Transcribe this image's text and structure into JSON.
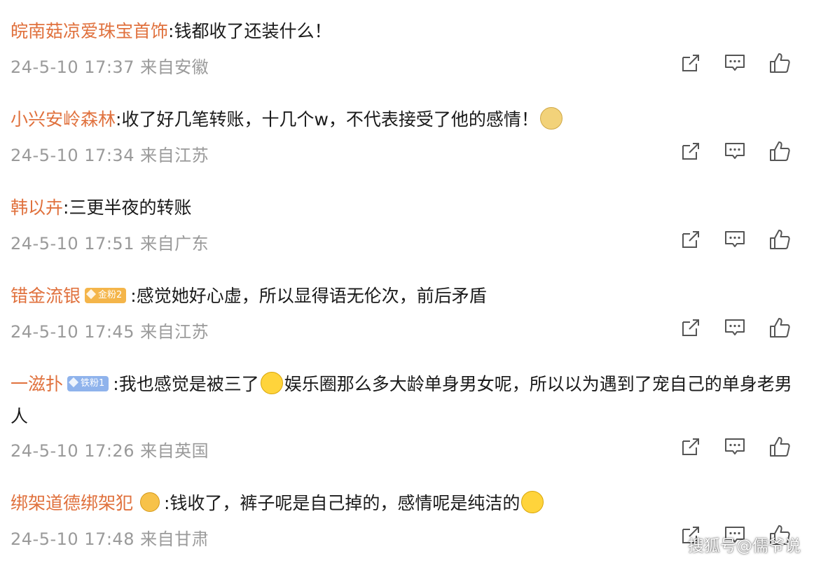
{
  "comments": [
    {
      "username": "皖南菇凉爱珠宝首饰",
      "separator": ":",
      "text": "钱都收了还装什么！",
      "time": "24-5-10 17:37",
      "location": "来自安徽"
    },
    {
      "username": "小兴安岭森林",
      "separator": ":",
      "text": "收了好几笔转账，十几个w，不代表接受了他的感情！",
      "emoji": "doge-emoji-icon",
      "time": "24-5-10 17:34",
      "location": "来自江苏"
    },
    {
      "username": "韩以卉",
      "separator": ":",
      "text": "三更半夜的转账",
      "time": "24-5-10 17:51",
      "location": "来自广东"
    },
    {
      "username": "错金流银",
      "badge": "金粉2",
      "separator": ":",
      "text": "感觉她好心虚，所以显得语无伦次，前后矛盾",
      "time": "24-5-10 17:45",
      "location": "来自江苏"
    },
    {
      "username": "一滋扑",
      "badge": "铁粉1",
      "separator": ":",
      "text_part1": "我也感觉是被三了",
      "emoji": "laugh-cry-emoji-icon",
      "text_part2": "娱乐圈那么多大龄单身男女呢，所以以为遇到了宠自己的单身老男人",
      "time": "24-5-10 17:26",
      "location": "来自英国"
    },
    {
      "username": "绑架道德绑架犯",
      "user_icon": "crown-icon",
      "separator": ":",
      "text": "钱收了，裤子呢是自己掉的，感情呢是纯洁的",
      "emoji": "laugh-cry-emoji-icon",
      "time": "24-5-10 17:48",
      "location": "来自甘肃"
    }
  ],
  "actions": {
    "share_icon": "share-icon",
    "comment_icon": "comment-icon",
    "like_icon": "thumbs-up-icon"
  },
  "watermark": "搜狐号@儒爷说",
  "colors": {
    "username": "#e0713d",
    "text": "#1a1a1a",
    "meta": "#9a9a9a",
    "icon": "#555555",
    "badge_gold": "#f4b54a",
    "badge_iron": "#8fb3ec"
  }
}
